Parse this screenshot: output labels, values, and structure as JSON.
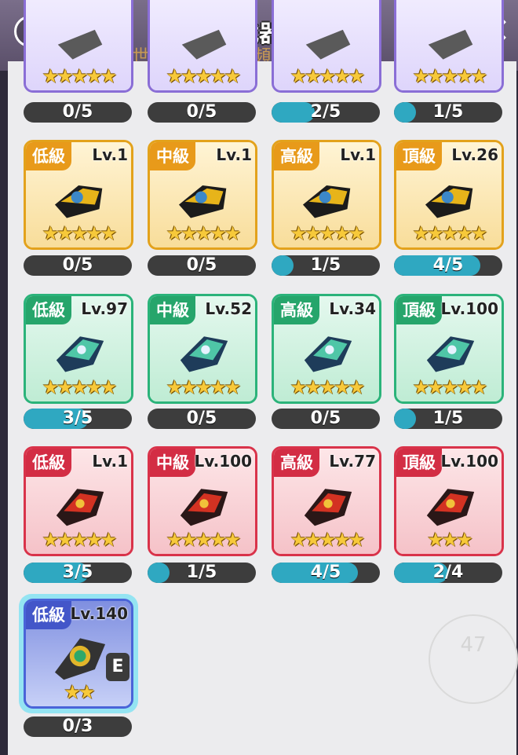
{
  "header": {
    "title": "武器",
    "help_icon": "question-icon",
    "close_icon": "close-icon",
    "background_text": "[世界]已進入1號頻道"
  },
  "colors": {
    "orange": "#e89a1a",
    "green": "#26a56b",
    "red": "#d32d44",
    "purple": "#8a6ed6",
    "blue": "#4356c9",
    "bar_fill": "#2fa8c1"
  },
  "weapons": [
    {
      "grade": "",
      "level": "",
      "stars": "★★★★★",
      "count": "0/5",
      "progress": 0,
      "color": "purple"
    },
    {
      "grade": "",
      "level": "",
      "stars": "★★★★★",
      "count": "0/5",
      "progress": 0,
      "color": "purple"
    },
    {
      "grade": "",
      "level": "",
      "stars": "★★★★★",
      "count": "2/5",
      "progress": 0.4,
      "color": "purple"
    },
    {
      "grade": "",
      "level": "",
      "stars": "★★★★★",
      "count": "1/5",
      "progress": 0.2,
      "color": "purple"
    },
    {
      "grade": "低級",
      "level": "Lv.1",
      "stars": "★★★★★",
      "count": "0/5",
      "progress": 0,
      "color": "orange"
    },
    {
      "grade": "中級",
      "level": "Lv.1",
      "stars": "★★★★★",
      "count": "0/5",
      "progress": 0,
      "color": "orange"
    },
    {
      "grade": "高級",
      "level": "Lv.1",
      "stars": "★★★★★",
      "count": "1/5",
      "progress": 0.2,
      "color": "orange"
    },
    {
      "grade": "頂級",
      "level": "Lv.26",
      "stars": "★★★★★",
      "count": "4/5",
      "progress": 0.8,
      "color": "orange"
    },
    {
      "grade": "低級",
      "level": "Lv.97",
      "stars": "★★★★★",
      "count": "3/5",
      "progress": 0.6,
      "color": "green"
    },
    {
      "grade": "中級",
      "level": "Lv.52",
      "stars": "★★★★★",
      "count": "0/5",
      "progress": 0,
      "color": "green"
    },
    {
      "grade": "高級",
      "level": "Lv.34",
      "stars": "★★★★★",
      "count": "0/5",
      "progress": 0,
      "color": "green"
    },
    {
      "grade": "頂級",
      "level": "Lv.100",
      "stars": "★★★★★",
      "count": "1/5",
      "progress": 0.2,
      "color": "green"
    },
    {
      "grade": "低級",
      "level": "Lv.1",
      "stars": "★★★★★",
      "count": "3/5",
      "progress": 0.6,
      "color": "red"
    },
    {
      "grade": "中級",
      "level": "Lv.100",
      "stars": "★★★★★",
      "count": "1/5",
      "progress": 0.2,
      "color": "red"
    },
    {
      "grade": "高級",
      "level": "Lv.77",
      "stars": "★★★★★",
      "count": "4/5",
      "progress": 0.8,
      "color": "red"
    },
    {
      "grade": "頂級",
      "level": "Lv.100",
      "stars": "★★★",
      "count": "2/4",
      "progress": 0.5,
      "color": "red"
    },
    {
      "grade": "低級",
      "level": "Lv.140",
      "stars": "★★",
      "count": "0/3",
      "progress": 0,
      "color": "blue",
      "equipped": "E"
    }
  ],
  "watermark": "47"
}
